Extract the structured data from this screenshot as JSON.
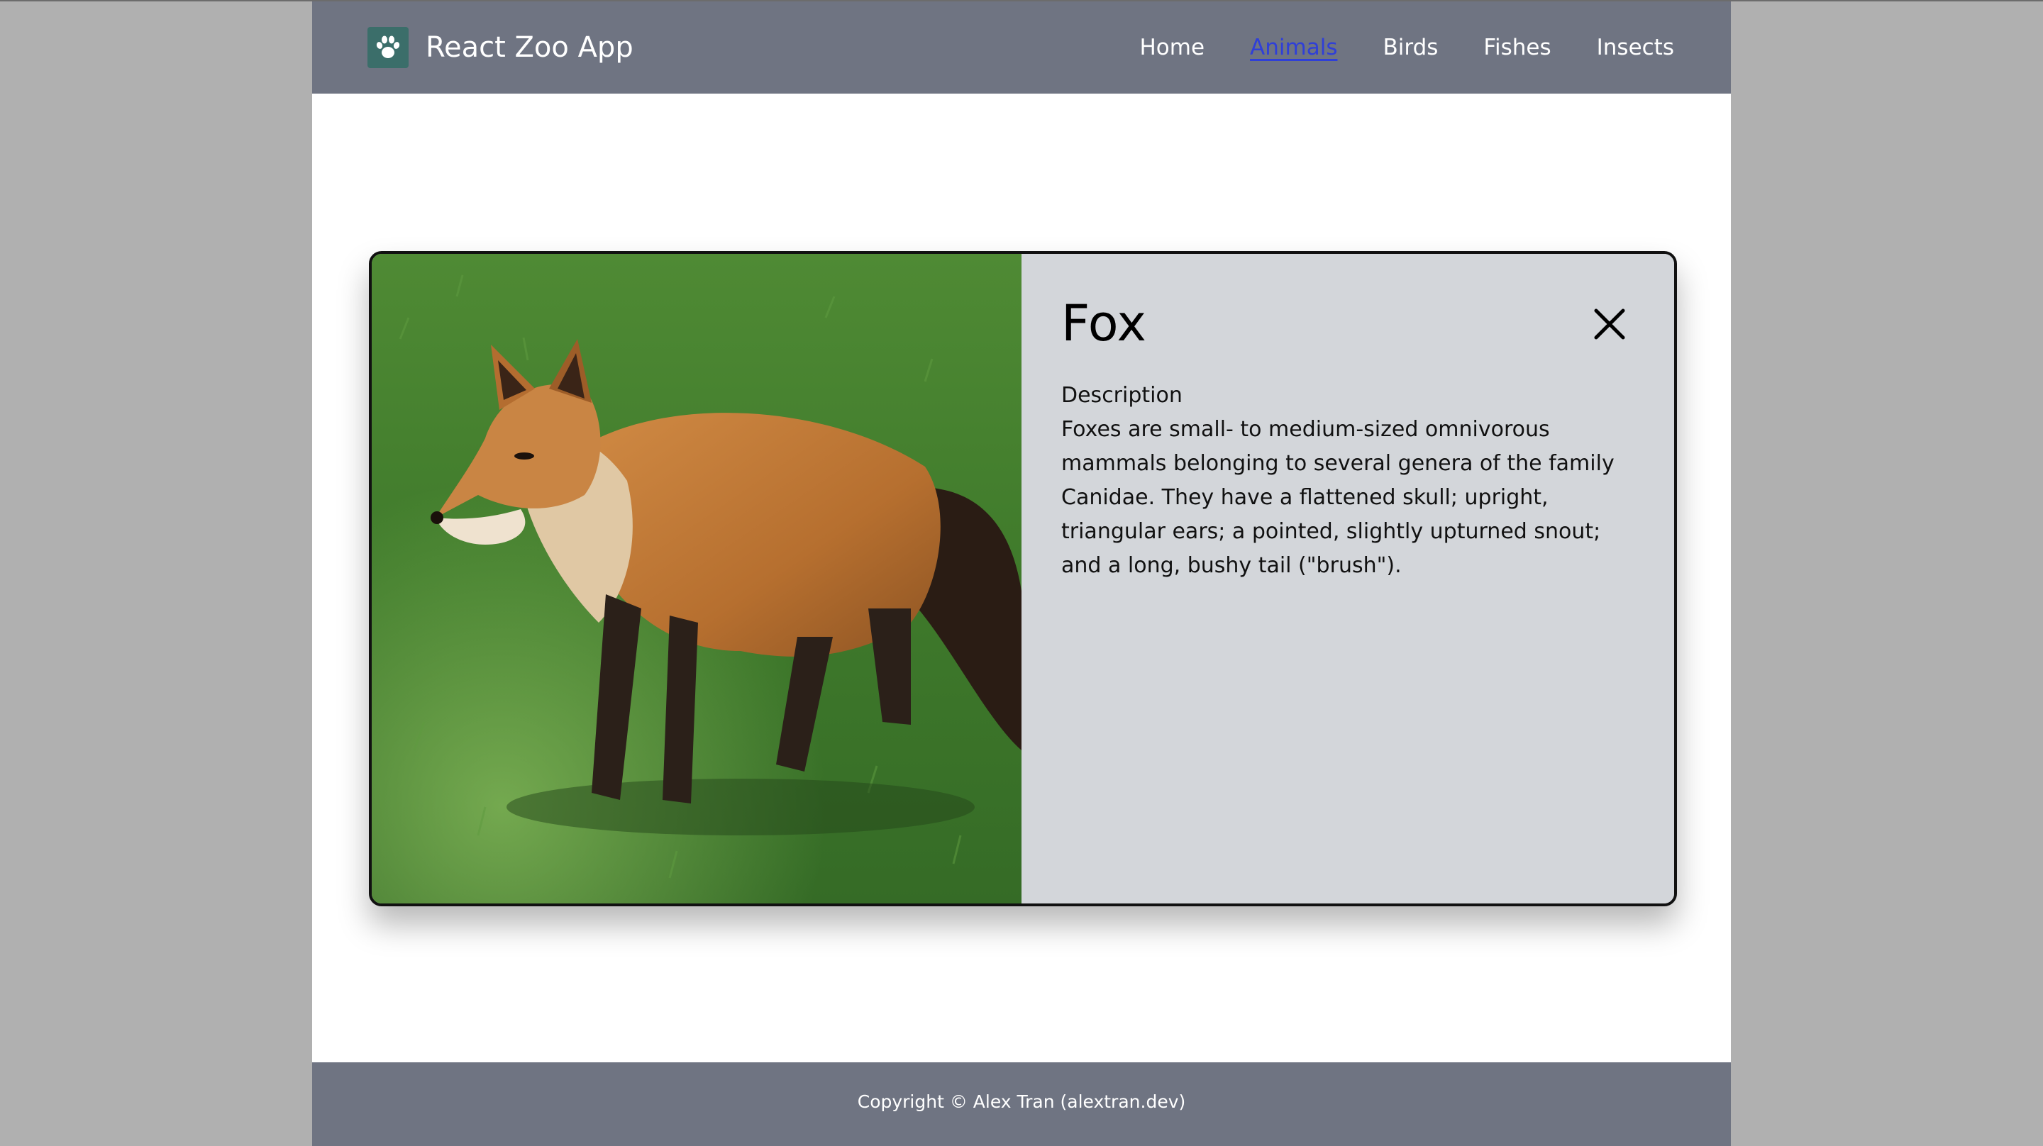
{
  "header": {
    "logo_icon": "paw-icon",
    "title": "React Zoo App",
    "nav": [
      {
        "label": "Home",
        "active": false
      },
      {
        "label": "Animals",
        "active": true
      },
      {
        "label": "Birds",
        "active": false
      },
      {
        "label": "Fishes",
        "active": false
      },
      {
        "label": "Insects",
        "active": false
      }
    ]
  },
  "card": {
    "image_subject": "fox",
    "name": "Fox",
    "close_icon": "close-icon",
    "description_label": "Description",
    "description": "Foxes are small- to medium-sized omnivorous mammals belonging to several genera of the family Canidae. They have a flattened skull; upright, triangular ears; a pointed, slightly upturned snout; and a long, bushy tail (\"brush\")."
  },
  "footer": {
    "copyright": "Copyright © Alex Tran (alextran.dev)"
  },
  "colors": {
    "header_bg": "#6f7482",
    "footer_bg": "#6f7482",
    "logo_bg": "#3b6e6a",
    "card_panel_bg": "#d3d6da",
    "active_link": "#2f3fd8",
    "page_margin_bg": "#b0b0b0"
  }
}
